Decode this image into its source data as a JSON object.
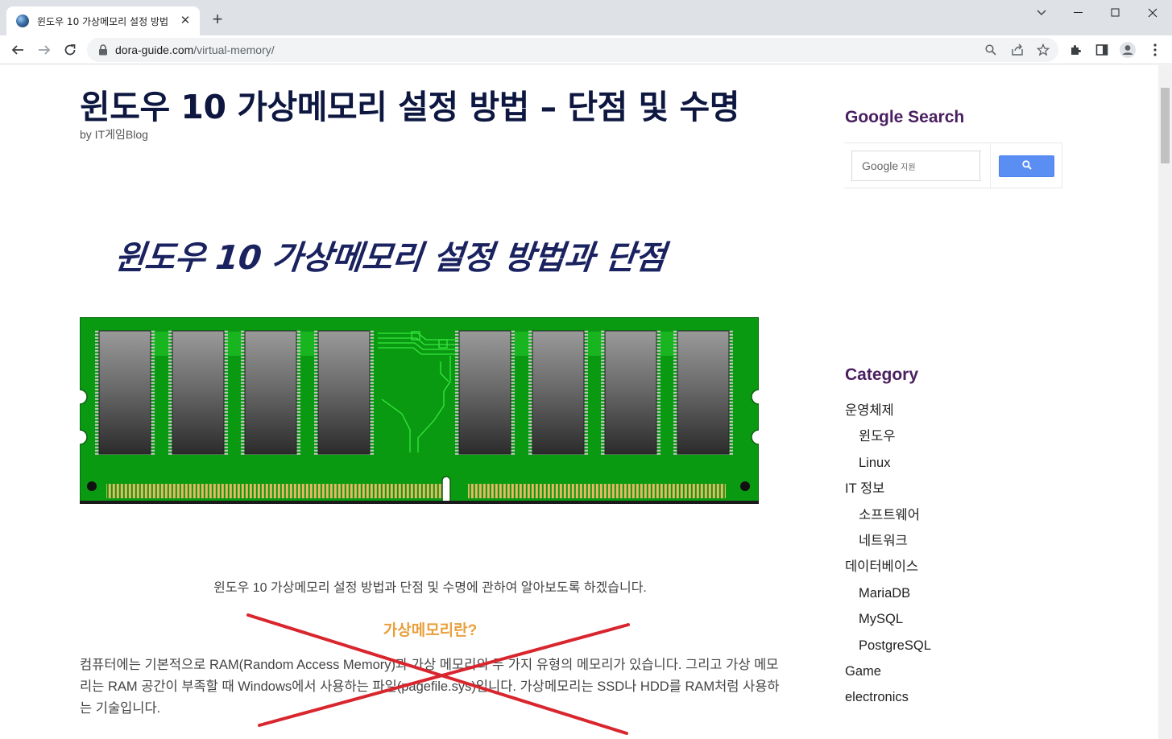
{
  "browser": {
    "tab_title": "윈도우 10 가상메모리 설정 방법",
    "url_domain": "dora-guide.com",
    "url_path": "/virtual-memory/",
    "new_tab_label": "+",
    "tab_close_label": "✕"
  },
  "post": {
    "title": "윈도우 10 가상메모리 설정 방법 – 단점 및 수명",
    "byline": "by IT게임Blog",
    "hero_caption": "윈도우 10 가상메모리 설정 방법과 단점",
    "intro": "윈도우 10 가상메모리 설정 방법과 단점 및 수명에 관하여 알아보도록 하겠습니다.",
    "section_heading": "가상메모리란?",
    "paragraph": "컴퓨터에는 기본적으로 RAM(Random Access Memory)과 가상 메모리의 두 가지 유형의 메모리가 있습니다. 그리고 가상 메모리는 RAM 공간이 부족할 때 Windows에서 사용하는 파일(pagefile.sys)입니다. 가상메모리는 SSD나 HDD를 RAM처럼 사용하는 기술입니다."
  },
  "sidebar": {
    "search_title": "Google Search",
    "search_placeholder_brand": "Google",
    "search_placeholder_suffix": "지원",
    "category_title": "Category",
    "categories": [
      {
        "label": "운영체제",
        "sub": false
      },
      {
        "label": "윈도우",
        "sub": true
      },
      {
        "label": "Linux",
        "sub": true
      },
      {
        "label": "IT 정보",
        "sub": false
      },
      {
        "label": "소프트웨어",
        "sub": true
      },
      {
        "label": "네트워크",
        "sub": true
      },
      {
        "label": "데이터베이스",
        "sub": false
      },
      {
        "label": "MariaDB",
        "sub": true
      },
      {
        "label": "MySQL",
        "sub": true
      },
      {
        "label": "PostgreSQL",
        "sub": true
      },
      {
        "label": "Game",
        "sub": false
      },
      {
        "label": "electronics",
        "sub": false
      }
    ]
  },
  "colors": {
    "title": "#0d1740",
    "widget_title": "#4a2060",
    "section_heading": "#e8a03c",
    "crossout": "#d9262e",
    "pcb_green": "#0a9a12"
  },
  "icons": [
    "globe-favicon",
    "close-icon",
    "plus-icon",
    "chevron-down-icon",
    "minimize-icon",
    "maximize-icon",
    "window-close-icon",
    "back-arrow-icon",
    "forward-arrow-icon",
    "reload-icon",
    "lock-icon",
    "zoom-icon",
    "share-icon",
    "star-icon",
    "puzzle-icon",
    "side-panel-icon",
    "profile-icon",
    "kebab-menu-icon",
    "search-icon"
  ]
}
